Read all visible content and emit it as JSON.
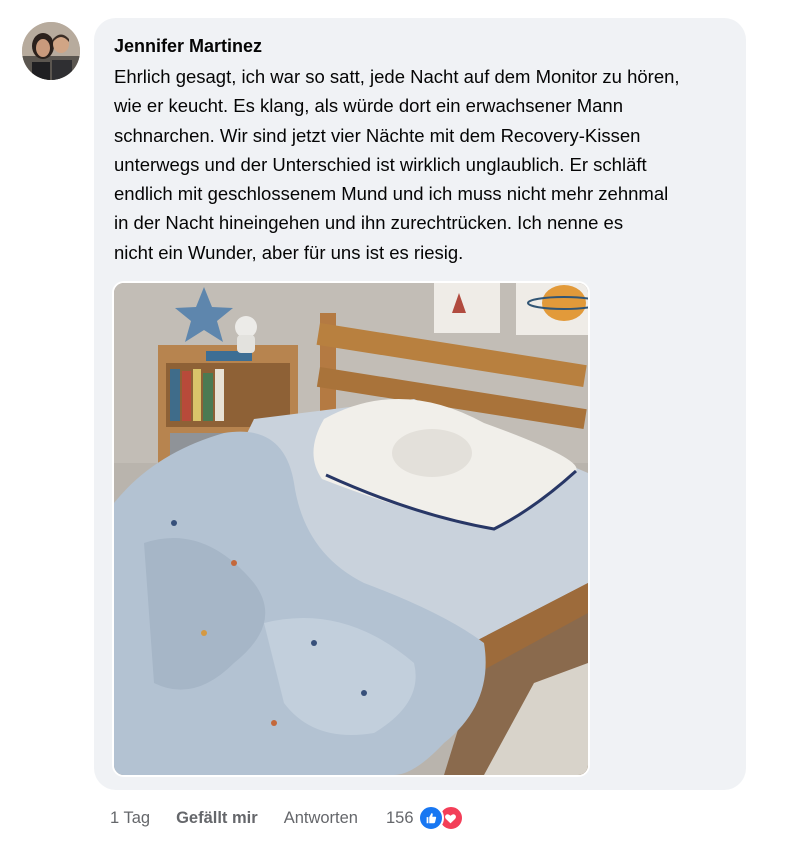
{
  "comment": {
    "author": "Jennifer Martinez",
    "text_lines": [
      "Ehrlich gesagt, ich war so satt, jede Nacht auf dem Monitor zu hören,",
      "wie er keucht. Es klang, als würde dort ein erwachsener Mann",
      "schnarchen. Wir sind jetzt vier Nächte mit dem Recovery-Kissen",
      "unterwegs und der Unterschied ist wirklich unglaublich. Er schläft",
      "endlich mit geschlossenem Mund und ich muss nicht mehr zehnmal",
      "in der Nacht hineingehen und ihn zurechtrücken. Ich nenne es",
      "nicht ein Wunder, aber für uns ist es riesig."
    ],
    "image_icon": "photo-child-bed-with-pillow"
  },
  "actions": {
    "time": "1 Tag",
    "like_label": "Gefällt mir",
    "reply_label": "Antworten",
    "reaction_count": "156",
    "reaction_icons": [
      "like-thumb-icon",
      "love-heart-icon"
    ]
  },
  "colors": {
    "bubble_bg": "#f0f2f5",
    "meta_text": "#65676b",
    "like_blue": "#1877f2",
    "love_red": "#f33e58"
  }
}
